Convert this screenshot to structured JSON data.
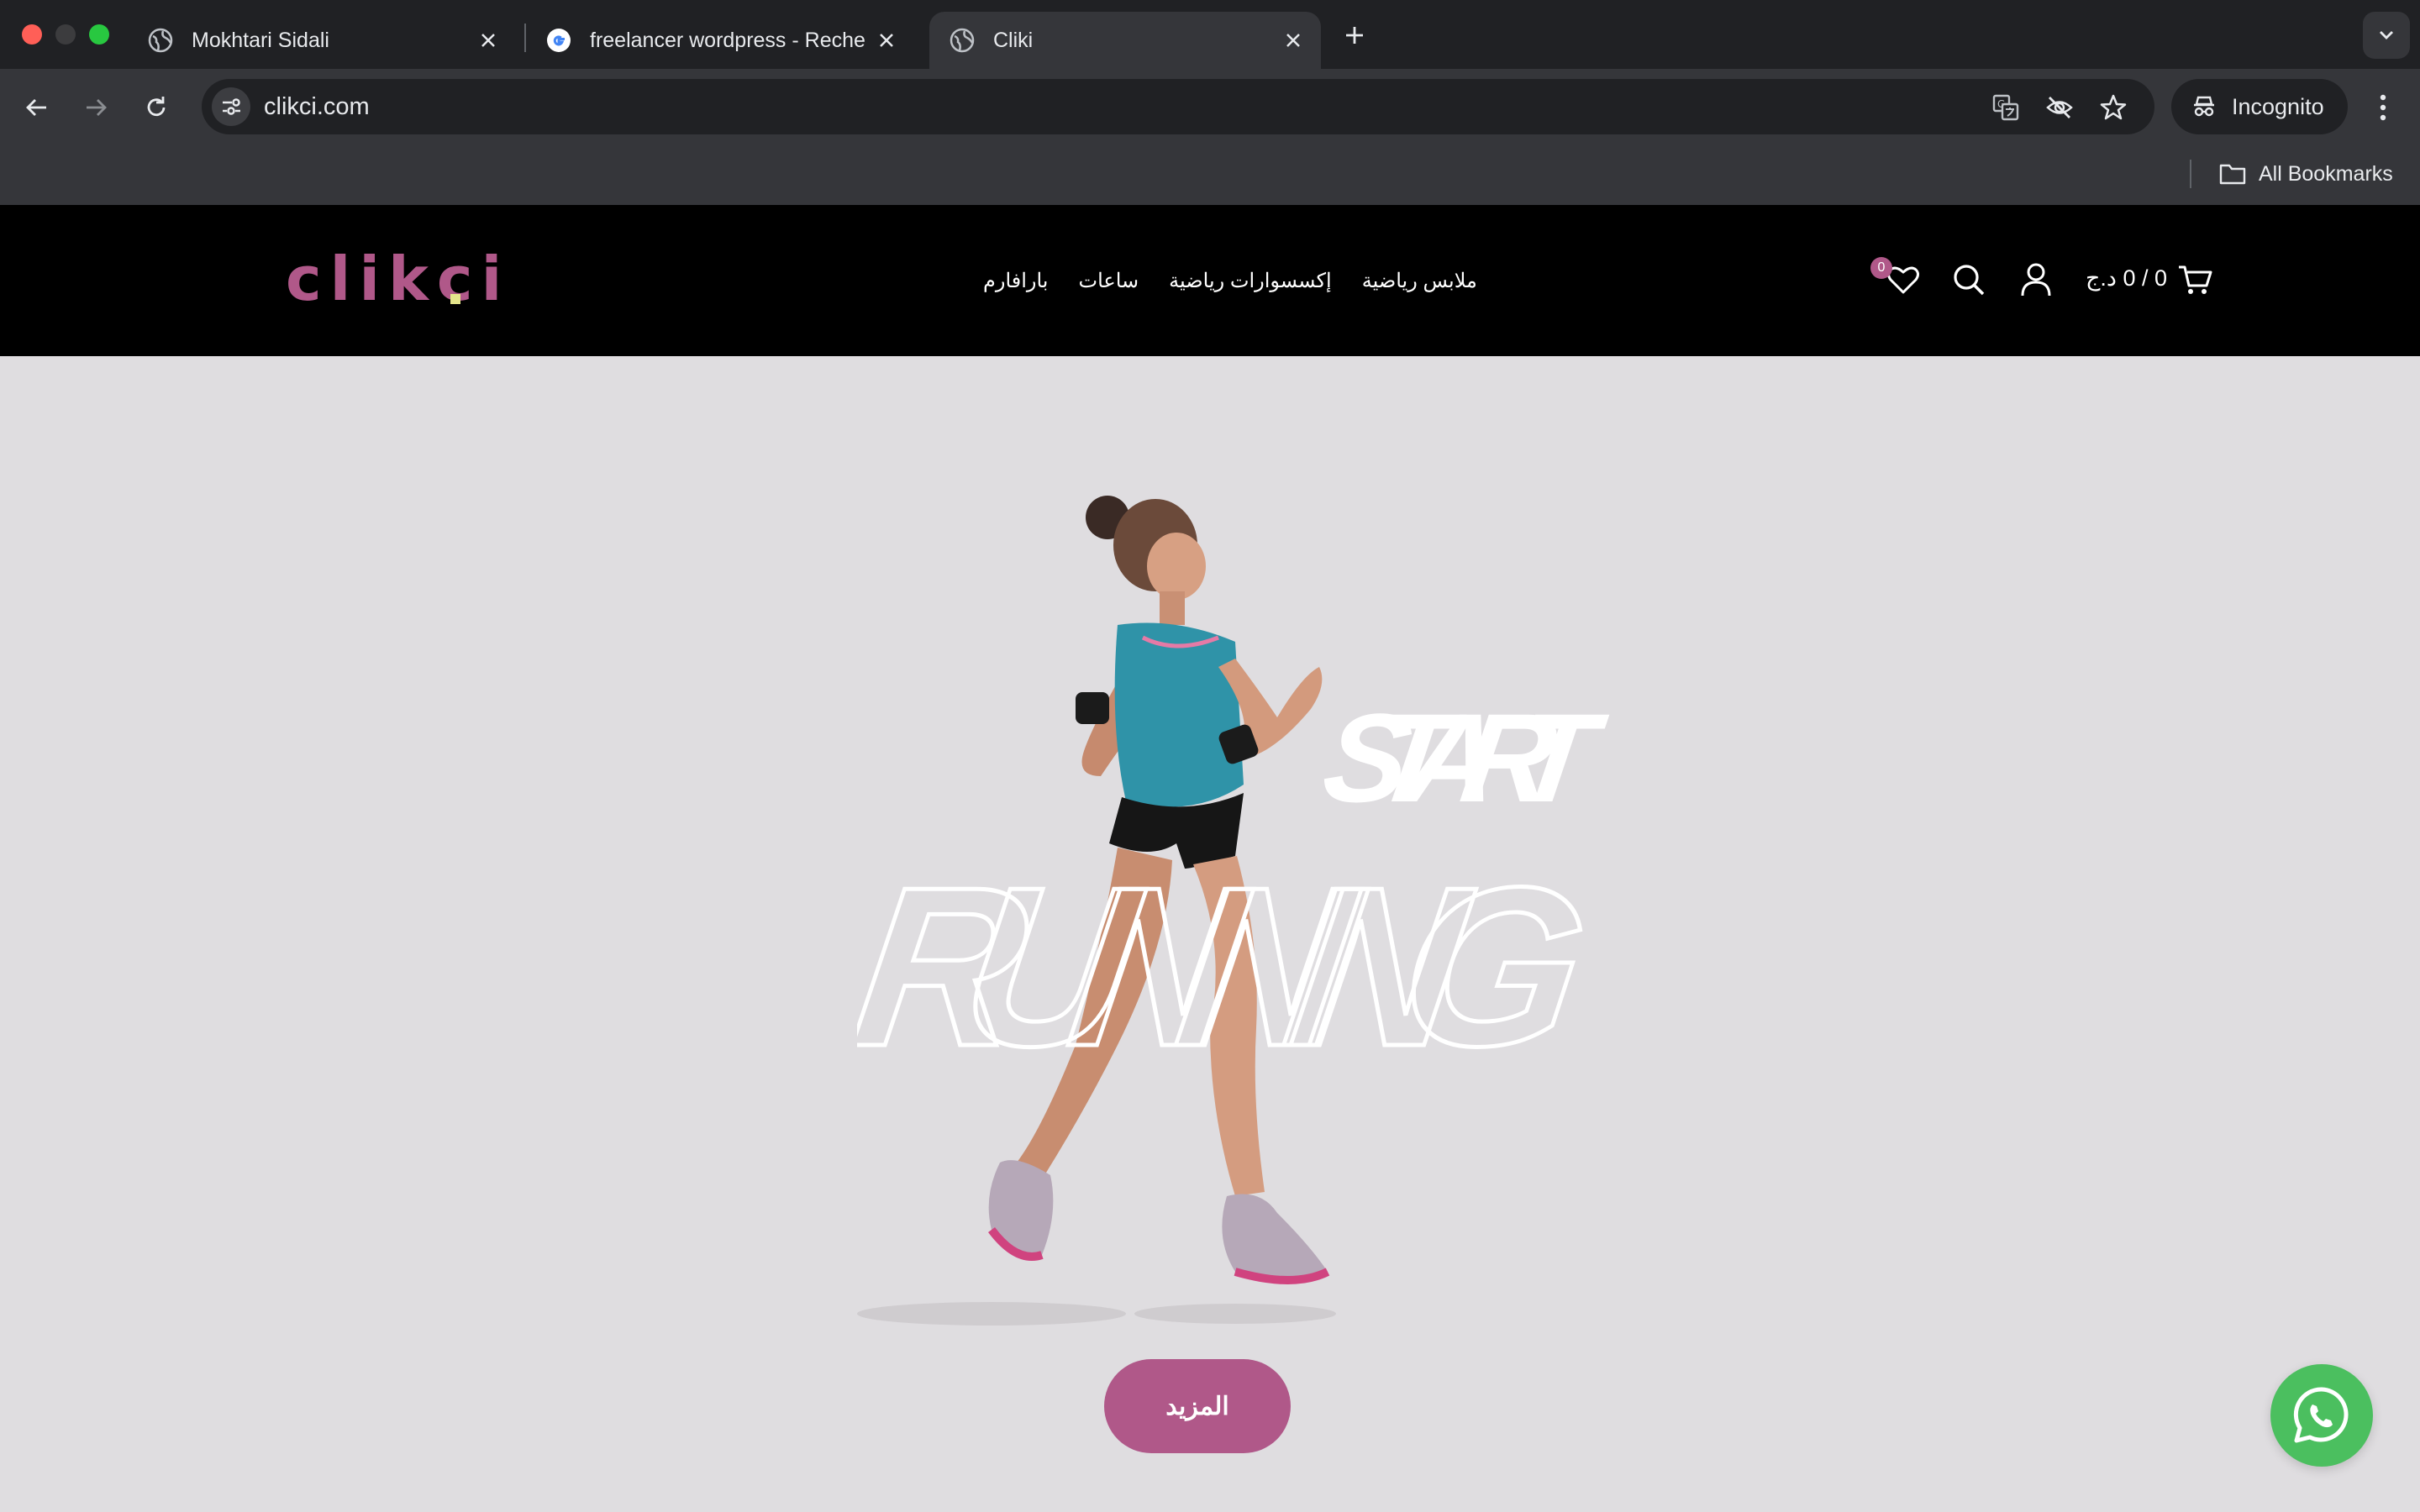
{
  "browser": {
    "tabs": [
      {
        "title": "Mokhtari Sidali",
        "icon": "globe-icon"
      },
      {
        "title": "freelancer wordpress - Reche",
        "icon": "google-icon"
      },
      {
        "title": "Cliki",
        "icon": "globe-icon",
        "active": true
      }
    ],
    "url": "clikci.com",
    "incognito_label": "Incognito",
    "bookmarks_label": "All Bookmarks"
  },
  "site": {
    "logo": "clikci",
    "brand_color": "#b05889",
    "nav": [
      "ملابس رياضية",
      "إكسسوارات رياضية",
      "ساعات",
      "بارافارم"
    ],
    "wishlist_count": "0",
    "cart_total": "0 / 0 د.ج"
  },
  "hero": {
    "headline_top": "START",
    "headline_bottom": "RUNNING",
    "button_label": "المزيد"
  }
}
